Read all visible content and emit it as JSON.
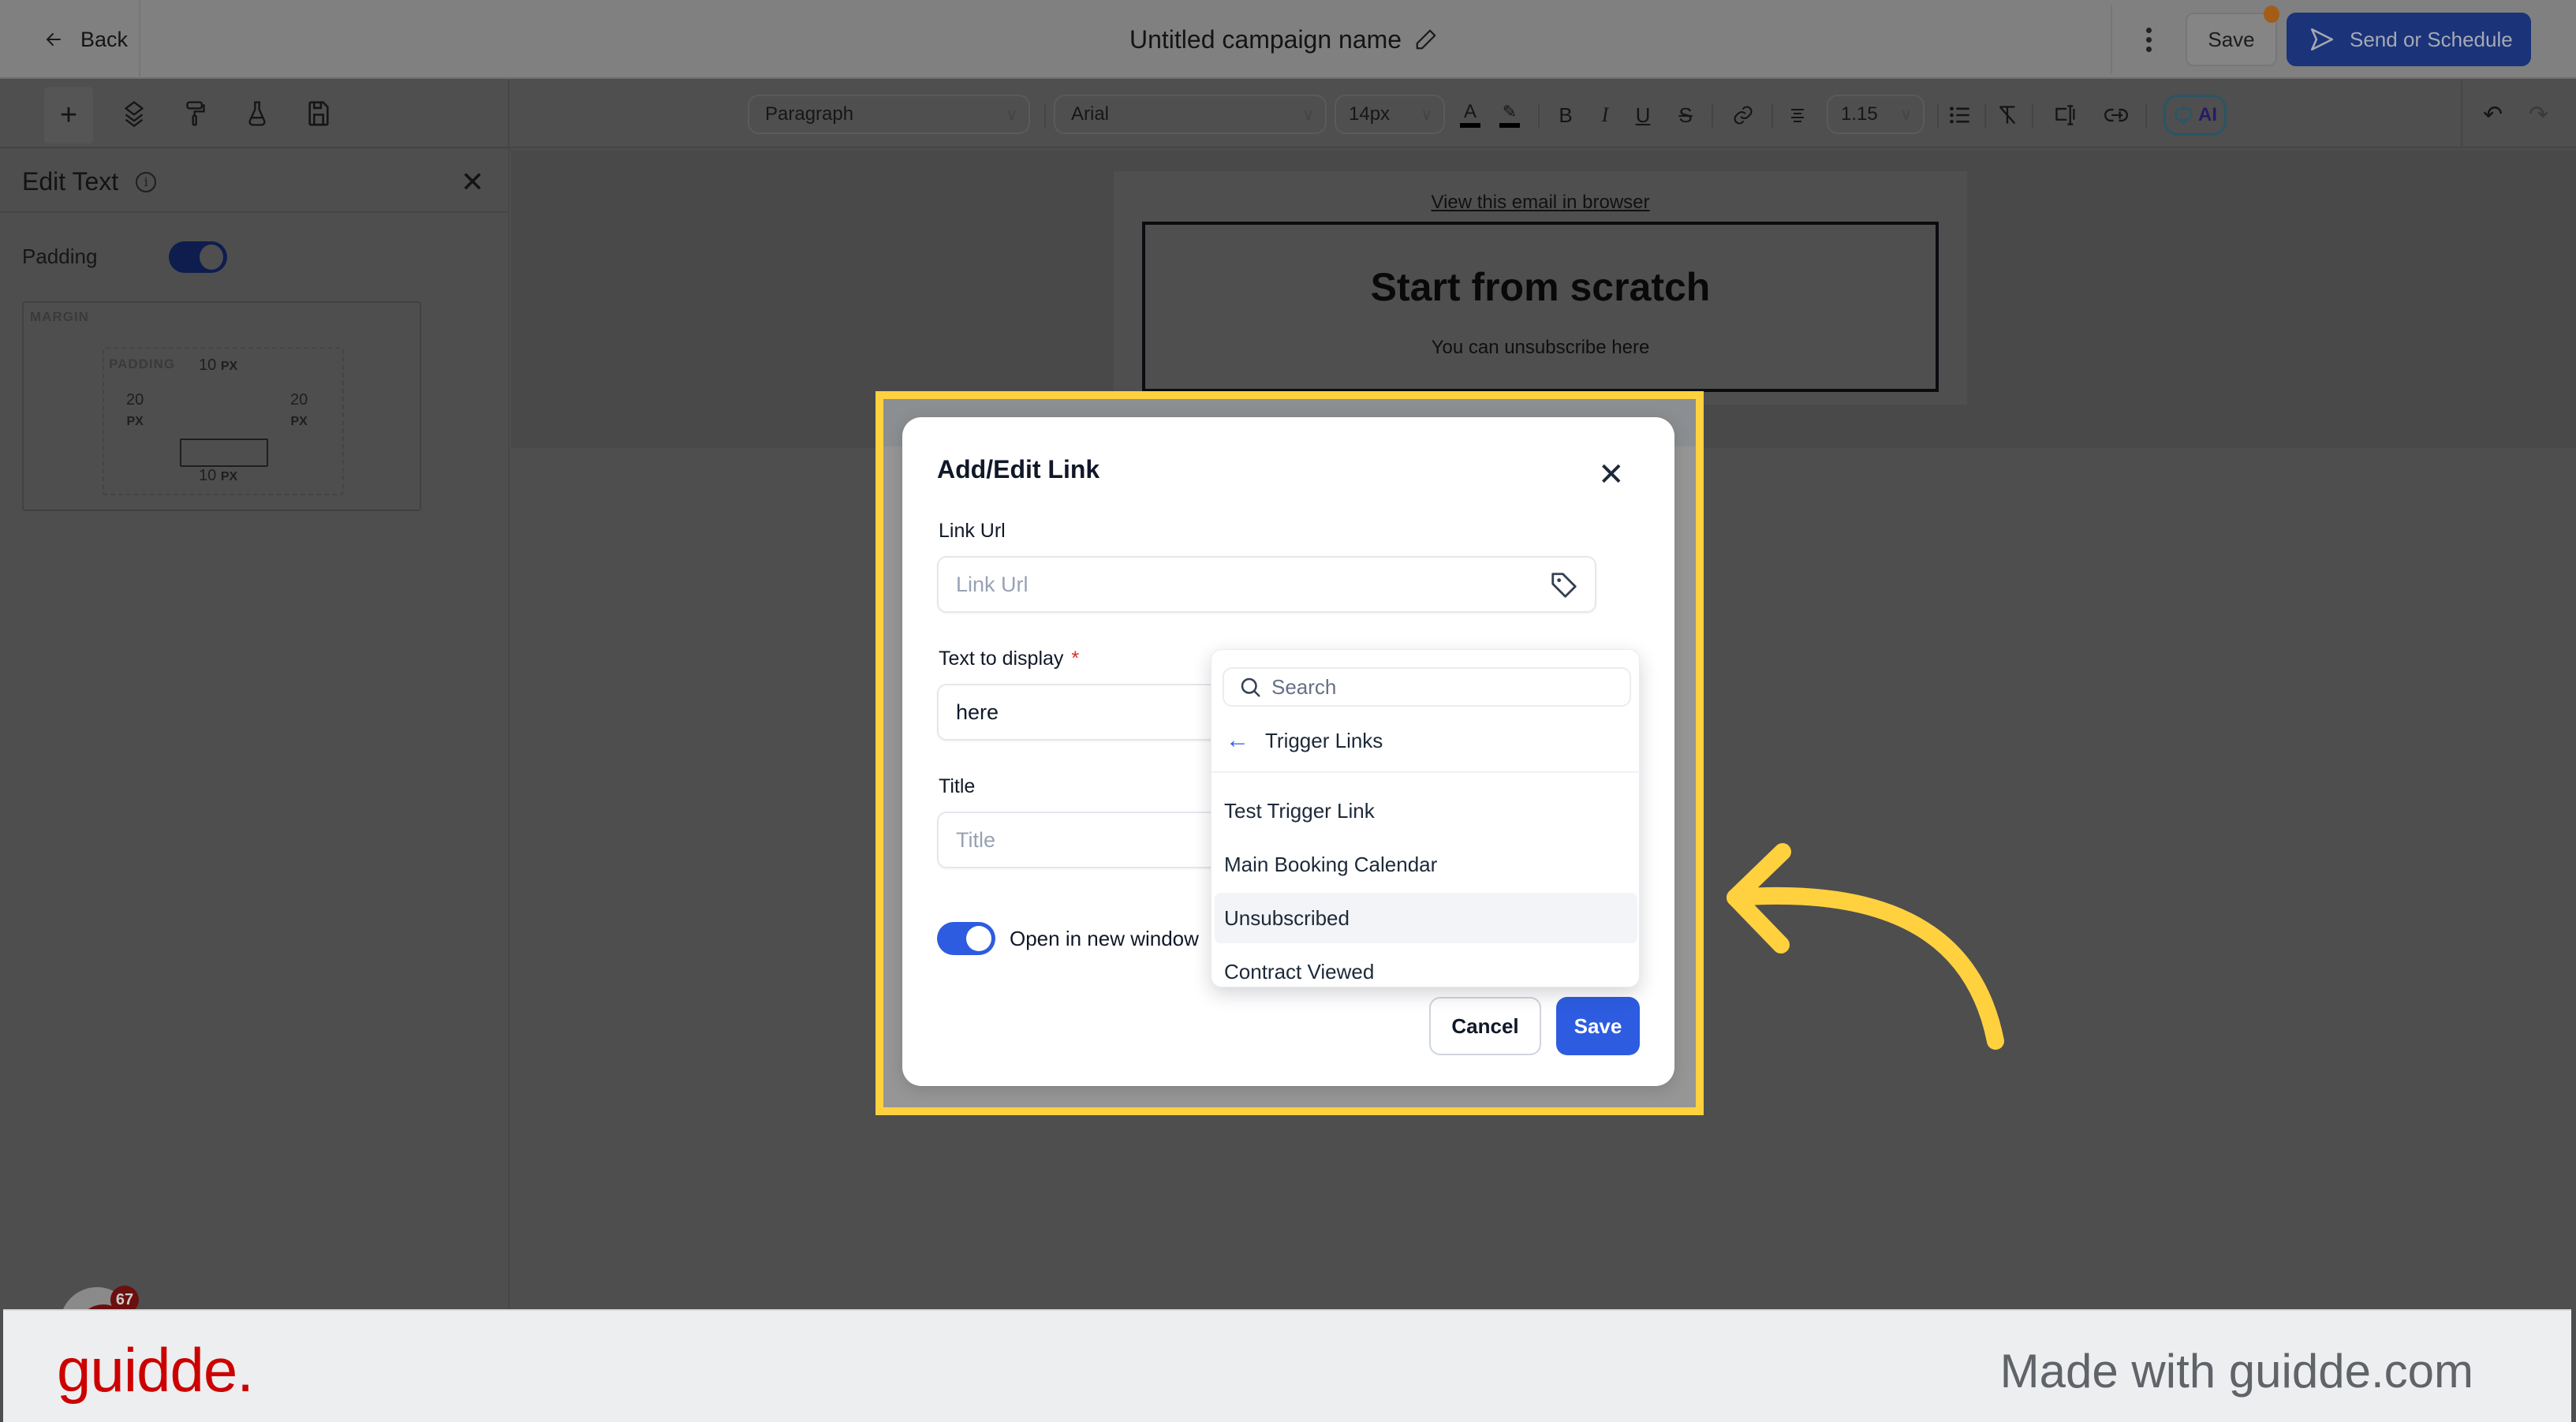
{
  "header": {
    "back_label": "Back",
    "campaign_title": "Untitled campaign name",
    "save_label": "Save",
    "send_label": "Send or Schedule",
    "colors": {
      "send_button": "#1a3379",
      "notification_dot": "#a35d19"
    }
  },
  "toolbar": {
    "icons": [
      "plus-icon",
      "layers-icon",
      "paint-roller-icon",
      "flask-icon",
      "save-disk-icon"
    ],
    "block_type": "Paragraph",
    "font_family": "Arial",
    "font_size": "14px",
    "line_height": "1.15",
    "format_icons": [
      "text-color-icon",
      "highlight-icon",
      "bold-icon",
      "italic-icon",
      "underline-icon",
      "strikethrough-icon",
      "link-icon",
      "align-center-icon",
      "list-icon",
      "clear-format-icon",
      "text-cursor-icon",
      "link-alt-icon"
    ],
    "ai_label": "AI"
  },
  "sidebar": {
    "title": "Edit Text",
    "padding_label": "Padding",
    "padding_enabled": true,
    "box_model": {
      "margin_label": "MARGIN",
      "padding_label": "PADDING",
      "top": "10",
      "bottom": "10",
      "left": "20",
      "right": "20",
      "unit": "PX"
    }
  },
  "email": {
    "view_in_browser": "View this email in browser",
    "heading": "Start from scratch",
    "body": "You can unsubscribe here"
  },
  "chat_widget": {
    "badge_count": "67"
  },
  "modal": {
    "title": "Add/Edit Link",
    "link_url_label": "Link Url",
    "link_url_placeholder": "Link Url",
    "link_url_value": "",
    "text_to_display_label": "Text to display",
    "text_to_display_required": "*",
    "text_to_display_value": "here",
    "title_label": "Title",
    "title_placeholder": "Title",
    "open_new_window_label": "Open in new window",
    "open_new_window_enabled": true,
    "cancel_label": "Cancel",
    "save_label": "Save",
    "colors": {
      "primary": "#2d5ce0",
      "highlight_border": "#ffd13f"
    }
  },
  "dropdown": {
    "search_placeholder": "Search",
    "back_label": "Trigger Links",
    "items": [
      {
        "label": "Test Trigger Link",
        "highlighted": false
      },
      {
        "label": "Main Booking Calendar",
        "highlighted": false
      },
      {
        "label": "Unsubscribed",
        "highlighted": true
      },
      {
        "label": "Contract Viewed",
        "highlighted": false
      }
    ]
  },
  "footer": {
    "brand": "guidde.",
    "made_with": "Made with guidde.com",
    "colors": {
      "brand": "#cc0000"
    }
  }
}
